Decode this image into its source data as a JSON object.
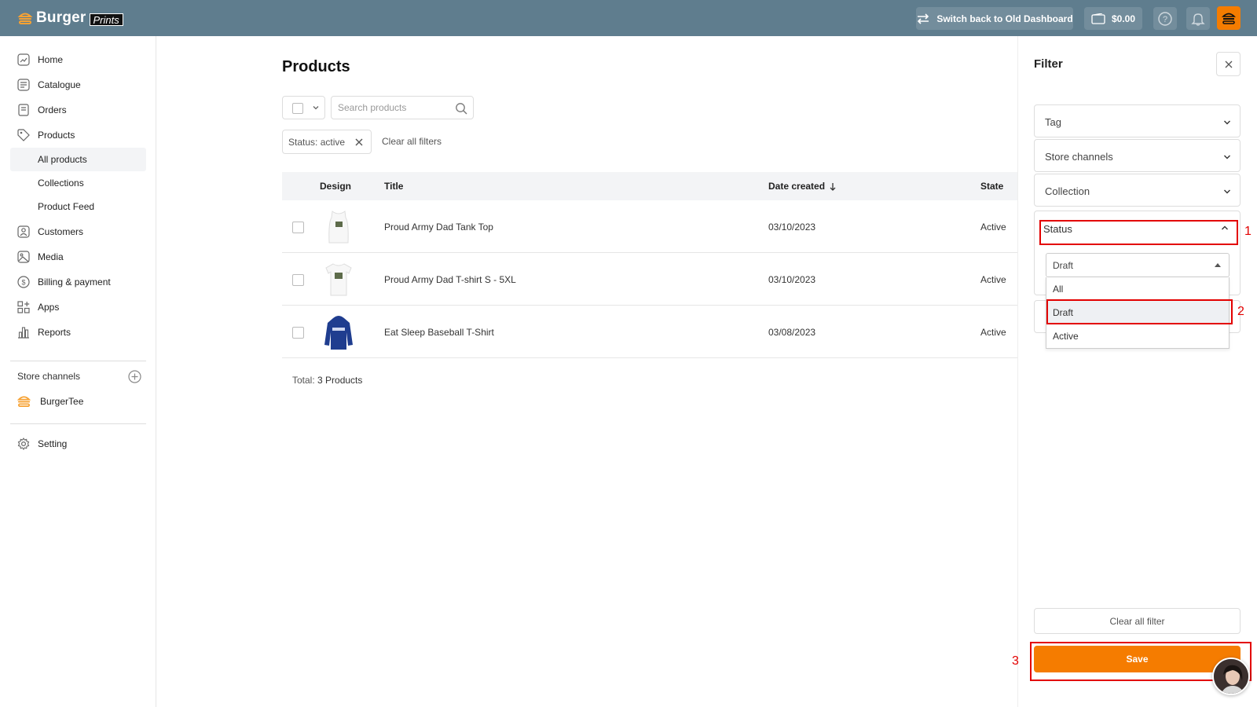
{
  "brand": {
    "name": "Burger",
    "tag": "Prints",
    "accent": "#f57c00",
    "topbar_color": "#5f7d8e"
  },
  "topbar": {
    "switch_label": "Switch back to Old Dashboard",
    "wallet_balance": "$0.00",
    "icons": [
      "switch-icon",
      "wallet-icon",
      "help-icon",
      "bell-icon",
      "burger-avatar-icon"
    ]
  },
  "sidebar": {
    "items": [
      {
        "label": "Home",
        "icon": "home-icon"
      },
      {
        "label": "Catalogue",
        "icon": "catalogue-icon"
      },
      {
        "label": "Orders",
        "icon": "orders-icon"
      },
      {
        "label": "Products",
        "icon": "tag-icon"
      }
    ],
    "product_subitems": [
      "All products",
      "Collections",
      "Product Feed"
    ],
    "items_after": [
      {
        "label": "Customers",
        "icon": "customers-icon"
      },
      {
        "label": "Media",
        "icon": "media-icon"
      },
      {
        "label": "Billing & payment",
        "icon": "dollar-icon"
      },
      {
        "label": "Apps",
        "icon": "apps-icon"
      },
      {
        "label": "Reports",
        "icon": "reports-icon"
      }
    ],
    "store_channels_label": "Store channels",
    "store_channel": "BurgerTee",
    "setting_label": "Setting"
  },
  "main": {
    "title": "Products",
    "search_placeholder": "Search products",
    "filter_chip": "Status: active",
    "clear_filters": "Clear all filters",
    "columns": [
      "Design",
      "Title",
      "Date created",
      "State"
    ],
    "rows": [
      {
        "title": "Proud Army Dad Tank Top",
        "date": "03/10/2023",
        "state": "Active",
        "design": "tank-top"
      },
      {
        "title": "Proud Army Dad T-shirt S - 5XL",
        "date": "03/10/2023",
        "state": "Active",
        "design": "t-shirt"
      },
      {
        "title": "Eat Sleep Baseball T-Shirt",
        "date": "03/08/2023",
        "state": "Active",
        "design": "hoodie"
      }
    ],
    "total_label": "Total:",
    "total_value": "3 Products"
  },
  "filter": {
    "title": "Filter",
    "sections": [
      "Tag",
      "Store channels",
      "Collection"
    ],
    "status_label": "Status",
    "status_selected": "Draft",
    "status_options": [
      "All",
      "Draft",
      "Active"
    ],
    "clear_all": "Clear all filter",
    "save": "Save"
  },
  "annotations": [
    "1",
    "2",
    "3"
  ]
}
